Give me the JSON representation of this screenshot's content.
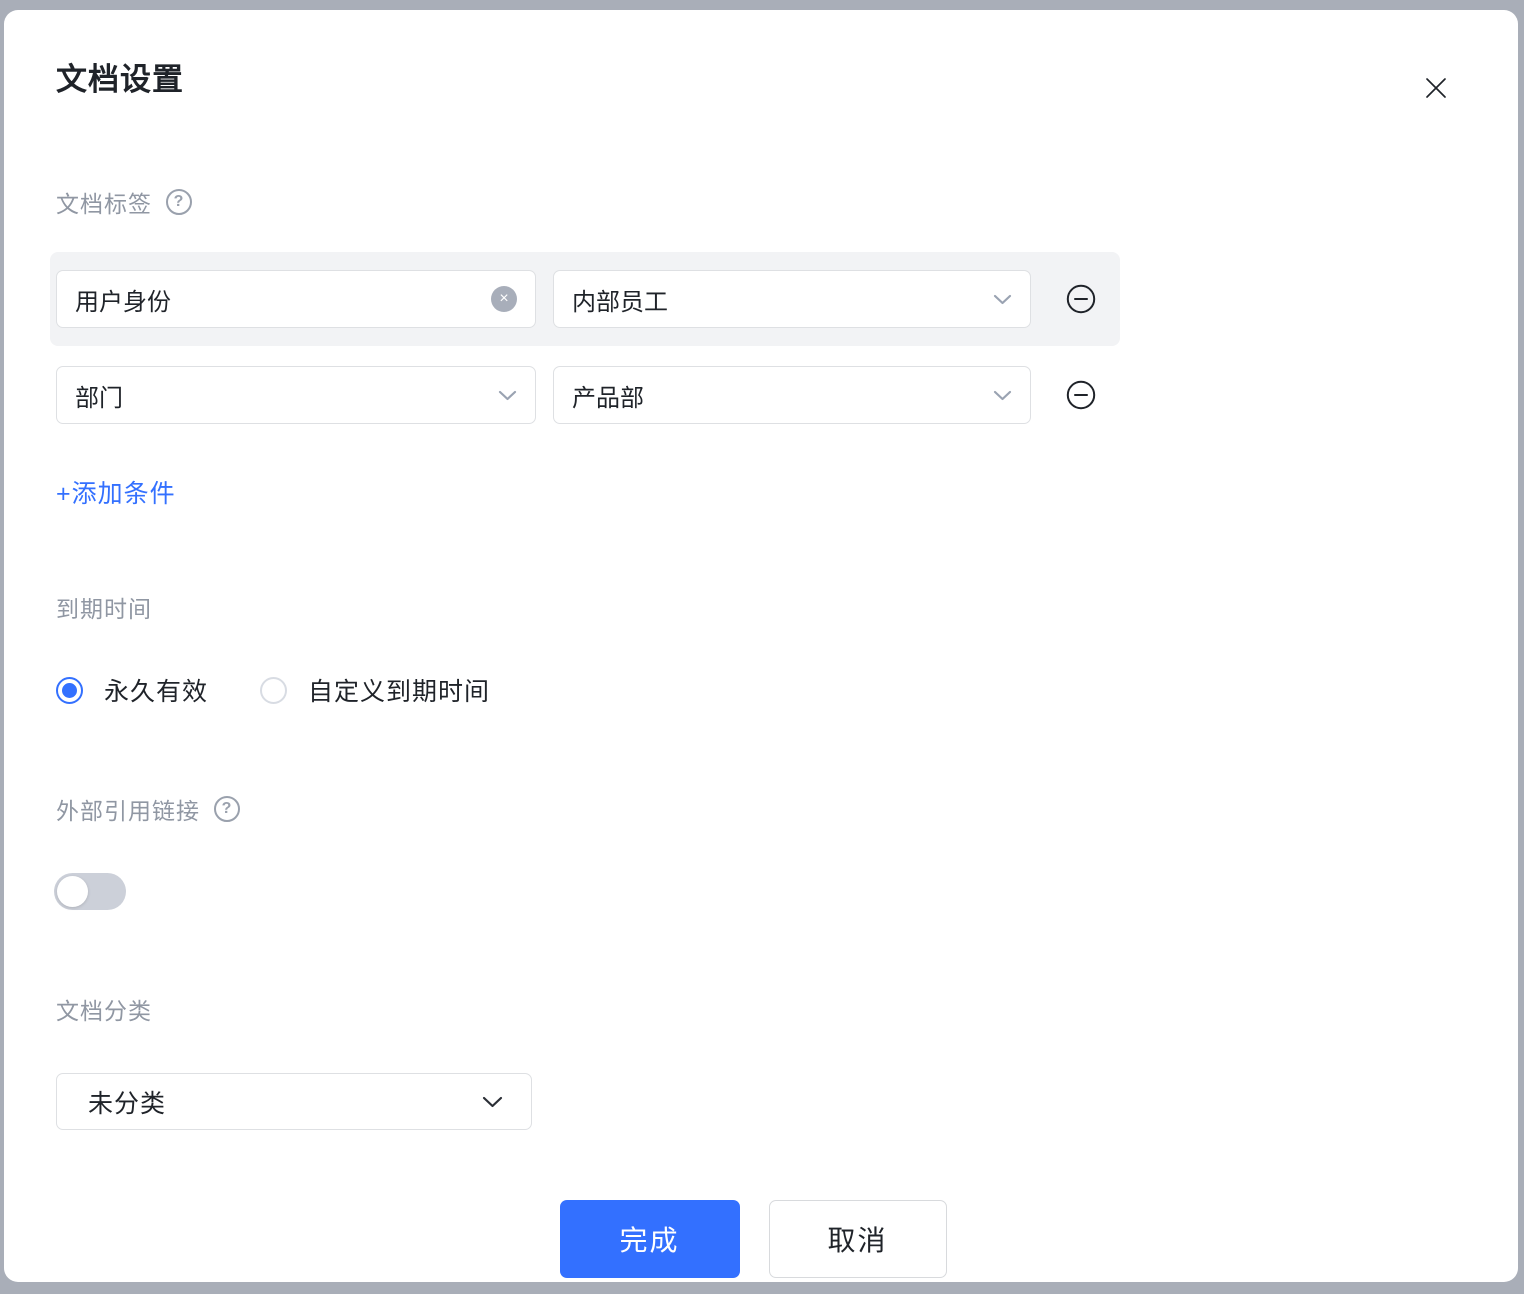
{
  "dialog": {
    "title": "文档设置"
  },
  "tags_section": {
    "label": "文档标签",
    "rows": [
      {
        "field1": "用户身份",
        "field2": "内部员工"
      },
      {
        "field1": "部门",
        "field2": "产品部"
      }
    ],
    "add_condition_label": "+添加条件"
  },
  "expiry_section": {
    "label": "到期时间",
    "options": [
      {
        "label": "永久有效",
        "selected": true
      },
      {
        "label": "自定义到期时间",
        "selected": false
      }
    ]
  },
  "external_link_section": {
    "label": "外部引用链接",
    "toggle_on": false
  },
  "category_section": {
    "label": "文档分类",
    "value": "未分类"
  },
  "footer": {
    "confirm_label": "完成",
    "cancel_label": "取消"
  },
  "icons": {
    "help": "?",
    "clear": "×"
  },
  "colors": {
    "accent_blue": "#3370ff",
    "panel_grey": "#f2f3f5",
    "border_grey": "#dee0e3",
    "label_grey": "#9097a3",
    "text_dark": "#1f2329",
    "backdrop_grey": "#a9aeb8",
    "toggle_track_grey": "#ccd0d9"
  }
}
